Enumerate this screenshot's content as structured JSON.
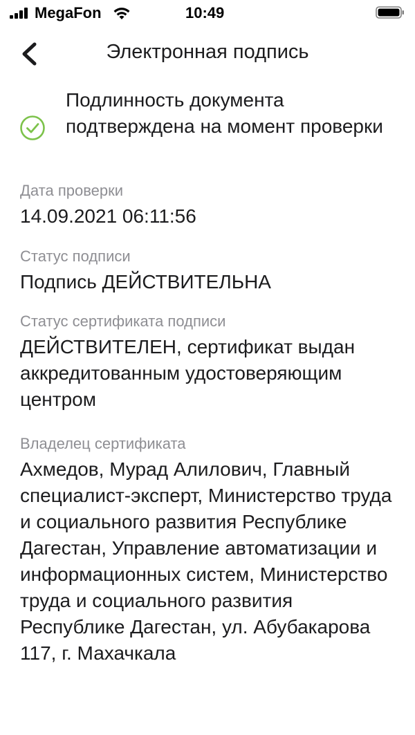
{
  "status_bar": {
    "carrier": "MegaFon",
    "time": "10:49",
    "icons": [
      "signal-icon",
      "wifi-icon",
      "battery-icon"
    ]
  },
  "nav": {
    "title": "Электронная подпись",
    "back_icon": "chevron-left-icon"
  },
  "verification": {
    "icon": "check-circle-icon",
    "text": "Подлинность документа подтверждена на момент проверки",
    "accent_color": "#7cc24a"
  },
  "fields": {
    "check_date": {
      "label": "Дата проверки",
      "value": "14.09.2021 06:11:56"
    },
    "signature_status": {
      "label": "Статус подписи",
      "value": "Подпись ДЕЙСТВИТЕЛЬНА"
    },
    "certificate_status": {
      "label": "Статус сертификата подписи",
      "value": "ДЕЙСТВИТЕЛЕН, сертификат выдан аккредитованным удостоверяющим центром"
    },
    "certificate_owner": {
      "label": "Владелец сертификата",
      "value": "Ахмедов, Мурад Алилович, Главный специалист-эксперт, Министерство труда и социального развития Республике Дагестан, Управление автоматизации и информационных систем, Министерство труда и социального развития Республике Дагестан, ул. Абубакарова 117, г. Махачкала"
    }
  },
  "colors": {
    "text_primary": "#1c1c1e",
    "text_secondary": "#8e8e93",
    "background": "#ffffff"
  }
}
